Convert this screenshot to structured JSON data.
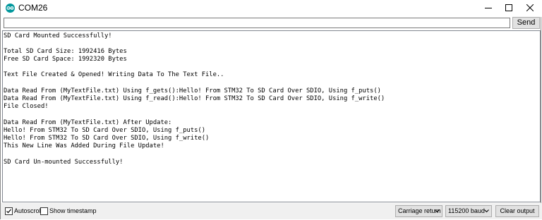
{
  "window": {
    "title": "COM26"
  },
  "send_bar": {
    "input_value": "",
    "send_label": "Send"
  },
  "output": {
    "lines": [
      "SD Card Mounted Successfully!",
      "",
      "Total SD Card Size: 1992416 Bytes",
      "Free SD Card Space: 1992320 Bytes",
      "",
      "Text File Created & Opened! Writing Data To The Text File..",
      "",
      "Data Read From (MyTextFile.txt) Using f_gets():Hello! From STM32 To SD Card Over SDIO, Using f_puts()",
      "Data Read From (MyTextFile.txt) Using f_read():Hello! From STM32 To SD Card Over SDIO, Using f_write()",
      "File Closed!",
      "",
      "Data Read From (MyTextFile.txt) After Update:",
      "Hello! From STM32 To SD Card Over SDIO, Using f_puts()",
      "Hello! From STM32 To SD Card Over SDIO, Using f_write()",
      "This New Line Was Added During File Update!",
      "",
      "SD Card Un-mounted Successfully!"
    ]
  },
  "bottom_bar": {
    "autoscroll_label": "Autoscroll",
    "autoscroll_checked": true,
    "timestamp_label": "Show timestamp",
    "timestamp_checked": false,
    "line_ending": "Carriage return",
    "baud_rate": "115200 baud",
    "clear_label": "Clear output"
  },
  "colors": {
    "app_icon": "#00979c",
    "button_face": "#e1e1e1",
    "bar_background": "#f0f0f0"
  },
  "icons": {
    "app": "arduino-icon",
    "minimize": "minimize-icon",
    "maximize": "maximize-icon",
    "close": "close-icon",
    "dropdown": "chevron-down-icon",
    "check": "checkmark-icon"
  }
}
